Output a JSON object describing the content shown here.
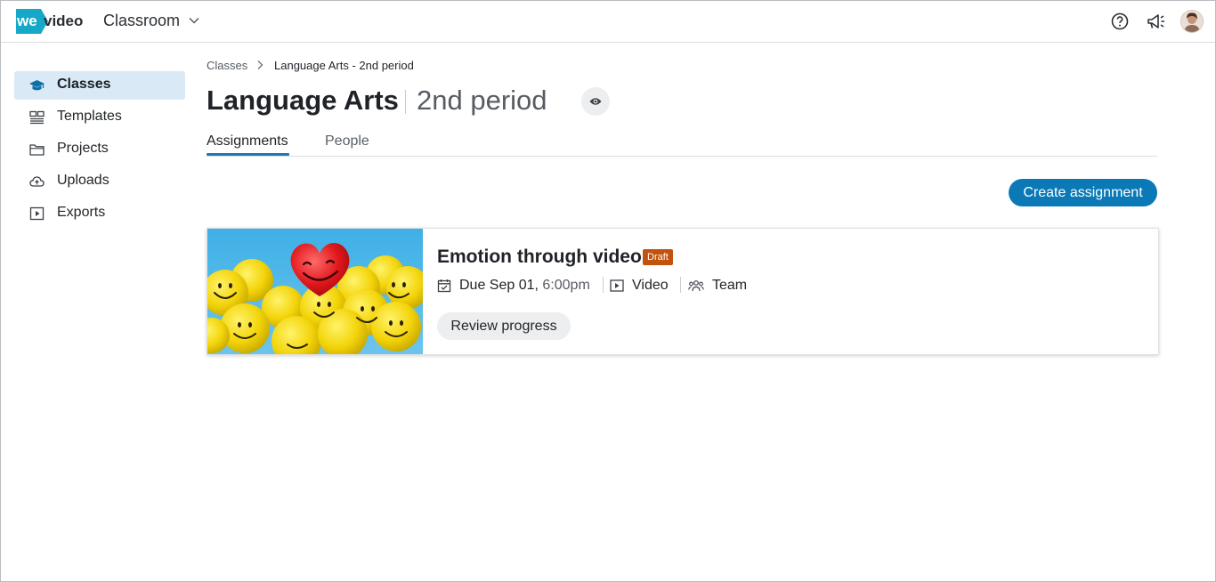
{
  "topbar": {
    "logo_text": "wevideo",
    "app_name": "Classroom",
    "icons": [
      "chevron-down-icon",
      "help-icon",
      "megaphone-icon",
      "avatar"
    ]
  },
  "sidebar": {
    "items": [
      {
        "label": "Classes",
        "icon": "graduation-cap-icon",
        "active": true
      },
      {
        "label": "Templates",
        "icon": "templates-icon",
        "active": false
      },
      {
        "label": "Projects",
        "icon": "folder-icon",
        "active": false
      },
      {
        "label": "Uploads",
        "icon": "cloud-upload-icon",
        "active": false
      },
      {
        "label": "Exports",
        "icon": "play-square-icon",
        "active": false
      }
    ]
  },
  "breadcrumb": {
    "root": "Classes",
    "current": "Language Arts - 2nd period"
  },
  "header": {
    "title": "Language Arts",
    "subtitle": "2nd period"
  },
  "tabs": [
    {
      "label": "Assignments",
      "active": true
    },
    {
      "label": "People",
      "active": false
    }
  ],
  "actions": {
    "create_label": "Create assignment"
  },
  "assignment": {
    "title": "Emotion through video",
    "badge": "Draft",
    "due_prefix": "Due Sep 01,",
    "due_time": "6:00pm",
    "type": "Video",
    "group": "Team",
    "review_label": "Review progress"
  },
  "colors": {
    "accent": "#0a79b6",
    "active_nav_bg": "#d9e9f5",
    "draft_badge": "#c2520c",
    "logo": "#15a8c8"
  }
}
